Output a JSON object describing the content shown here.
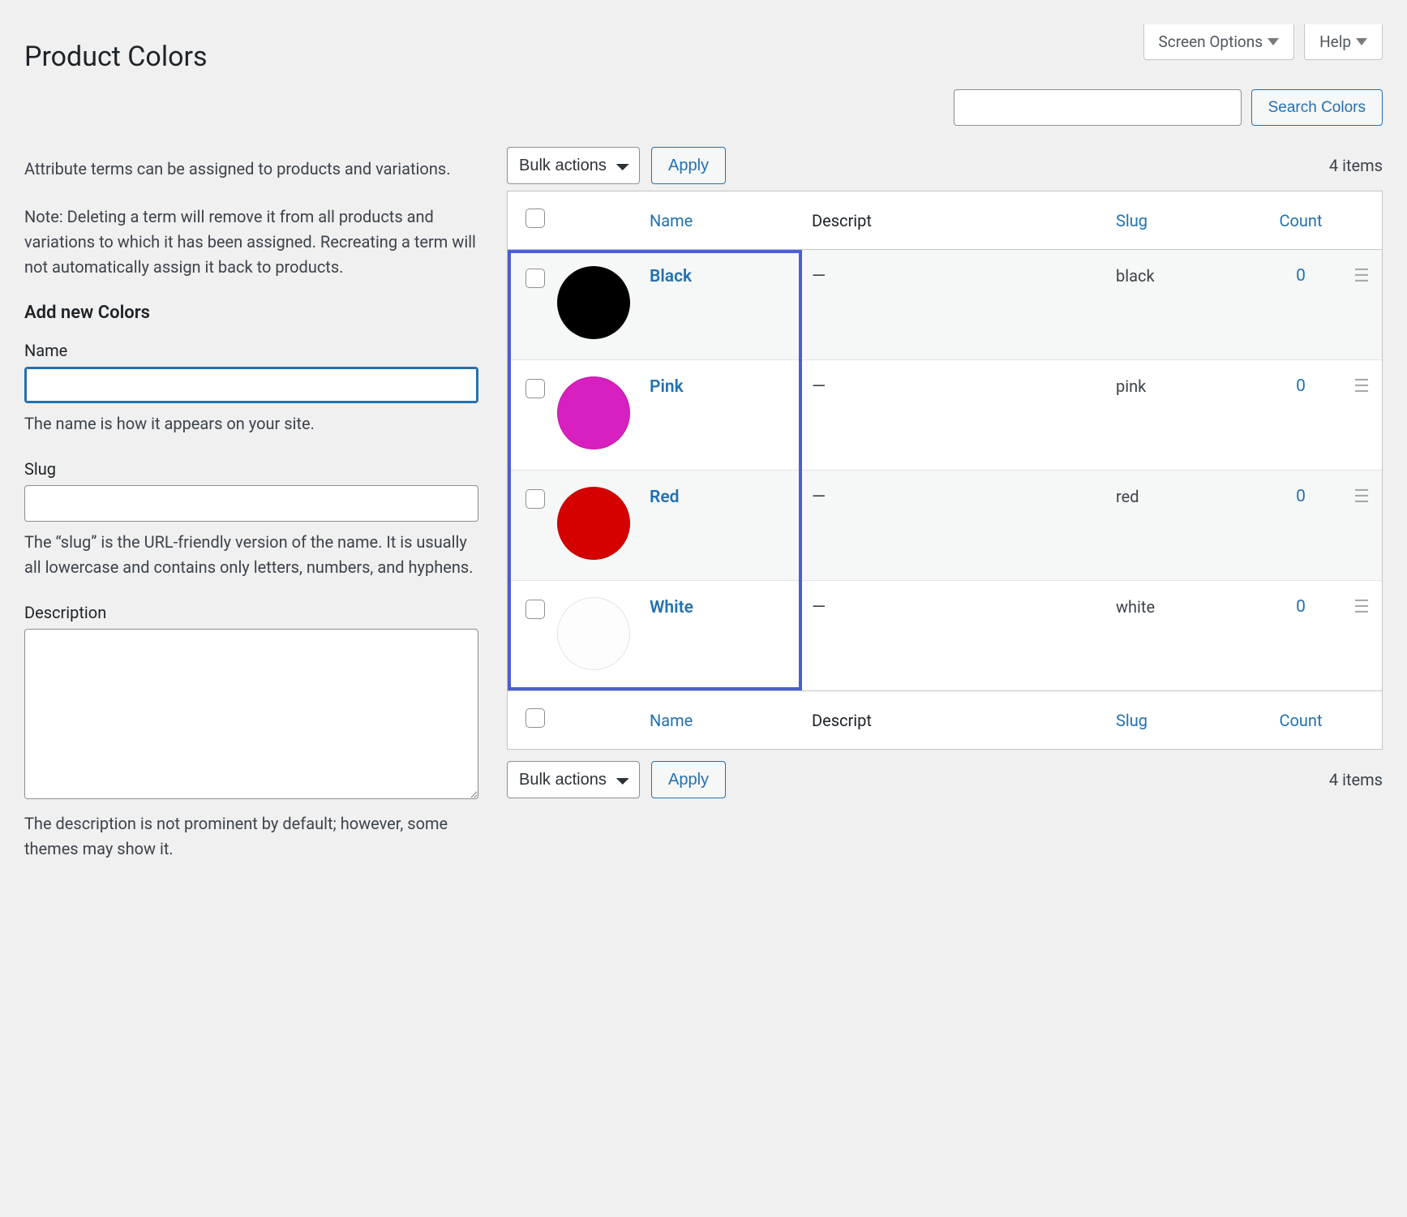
{
  "topTabs": {
    "screenOptions": "Screen Options",
    "help": "Help"
  },
  "pageTitle": "Product Colors",
  "search": {
    "value": "",
    "button": "Search Colors"
  },
  "intro1": "Attribute terms can be assigned to products and variations.",
  "intro2": "Note: Deleting a term will remove it from all products and variations to which it has been assigned. Recreating a term will not automatically assign it back to products.",
  "form": {
    "heading": "Add new Colors",
    "name": {
      "label": "Name",
      "value": "",
      "help": "The name is how it appears on your site."
    },
    "slug": {
      "label": "Slug",
      "value": "",
      "help": "The “slug” is the URL-friendly version of the name. It is usually all lowercase and contains only letters, numbers, and hyphens."
    },
    "description": {
      "label": "Description",
      "value": "",
      "help": "The description is not prominent by default; however, some themes may show it."
    }
  },
  "bulk": {
    "selectLabel": "Bulk actions",
    "apply": "Apply"
  },
  "itemsCount": "4 items",
  "columns": {
    "name": "Name",
    "description": "Descript",
    "slug": "Slug",
    "count": "Count"
  },
  "terms": [
    {
      "name": "Black",
      "swatch": "#000000",
      "description": "—",
      "slug": "black",
      "count": "0"
    },
    {
      "name": "Pink",
      "swatch": "#d81fbf",
      "description": "—",
      "slug": "pink",
      "count": "0"
    },
    {
      "name": "Red",
      "swatch": "#d50000",
      "description": "—",
      "slug": "red",
      "count": "0"
    },
    {
      "name": "White",
      "swatch": "#fdfdfd",
      "description": "—",
      "slug": "white",
      "count": "0"
    }
  ]
}
